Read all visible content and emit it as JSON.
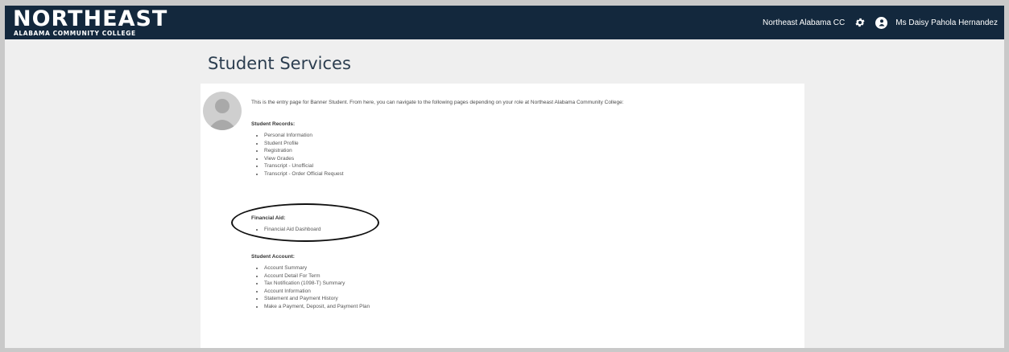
{
  "header": {
    "logo_main": "NORTHEAST",
    "logo_sub": "ALABAMA COMMUNITY COLLEGE",
    "institution_link": "Northeast Alabama CC",
    "user_name": "Ms Daisy Pahola Hernandez"
  },
  "page": {
    "title": "Student Services",
    "intro": "This is the entry page for Banner Student. From here, you can navigate to the following pages depending on your role at Northeast Alabama Community College:"
  },
  "sections": {
    "records": {
      "title": "Student Records:",
      "items": [
        "Personal Information",
        "Student Profile",
        "Registration",
        "View Grades",
        "Transcript - Unofficial",
        "Transcript - Order Official Request"
      ]
    },
    "aid": {
      "title": "Financial Aid:",
      "items": [
        "Financial Aid Dashboard"
      ]
    },
    "account": {
      "title": "Student Account:",
      "items": [
        "Account Summary",
        "Account Detail For Term",
        "Tax Notification (1098-T) Summary",
        "Account Information",
        "Statement and Payment History",
        "Make a Payment, Deposit, and Payment Plan"
      ]
    }
  },
  "colors": {
    "header_bg": "#13283d",
    "page_bg": "#efefef",
    "panel_bg": "#ffffff",
    "title": "#2c3e50"
  },
  "icons": [
    "gear-icon",
    "user-icon",
    "avatar-placeholder"
  ]
}
